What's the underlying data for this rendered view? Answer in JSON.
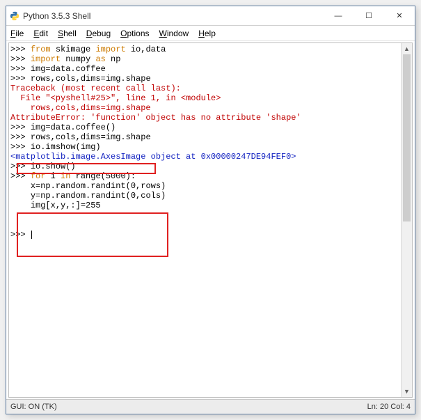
{
  "window": {
    "title": "Python 3.5.3 Shell",
    "icon": "python-icon"
  },
  "controls": {
    "min": "—",
    "max": "☐",
    "close": "✕"
  },
  "menu": {
    "file": {
      "ul": "F",
      "rest": "ile"
    },
    "edit": {
      "ul": "E",
      "rest": "dit"
    },
    "shell": {
      "ul": "S",
      "rest": "hell"
    },
    "debug": {
      "ul": "D",
      "rest": "ebug"
    },
    "options": {
      "ul": "O",
      "rest": "ptions"
    },
    "window": {
      "ul": "W",
      "rest": "indow"
    },
    "help": {
      "ul": "H",
      "rest": "elp"
    }
  },
  "code": {
    "prompt": ">>> ",
    "l1": {
      "kw1": "from",
      "a": " skimage ",
      "kw2": "import",
      "b": " io,data"
    },
    "l2": {
      "kw1": "import",
      "a": " numpy ",
      "kw2": "as",
      "b": " np"
    },
    "l3": "img=data.coffee",
    "l4": "rows,cols,dims=img.shape",
    "tb1": "Traceback (most recent call last):",
    "tb2": "  File \"<pyshell#25>\", line 1, in <module>",
    "tb3": "    rows,cols,dims=img.shape",
    "tb4": "AttributeError: 'function' object has no attribute 'shape'",
    "l5": "img=data.coffee()",
    "l6": "rows,cols,dims=img.shape",
    "l7": "io.imshow(img)",
    "repr": "<matplotlib.image.AxesImage object at 0x00000247DE94FEF0>",
    "l8": "io.show()",
    "l9": {
      "kw1": "for",
      "a": " i ",
      "kw2": "in",
      "b": " range(5000):"
    },
    "l10": "x=np.random.randint(0,rows)",
    "l11": "y=np.random.randint(0,cols)",
    "l12": "img[x,y,:]=255",
    "blank": "",
    "indent": "    "
  },
  "status": {
    "left": "GUI: ON (TK)",
    "right": "Ln: 20  Col: 4"
  }
}
